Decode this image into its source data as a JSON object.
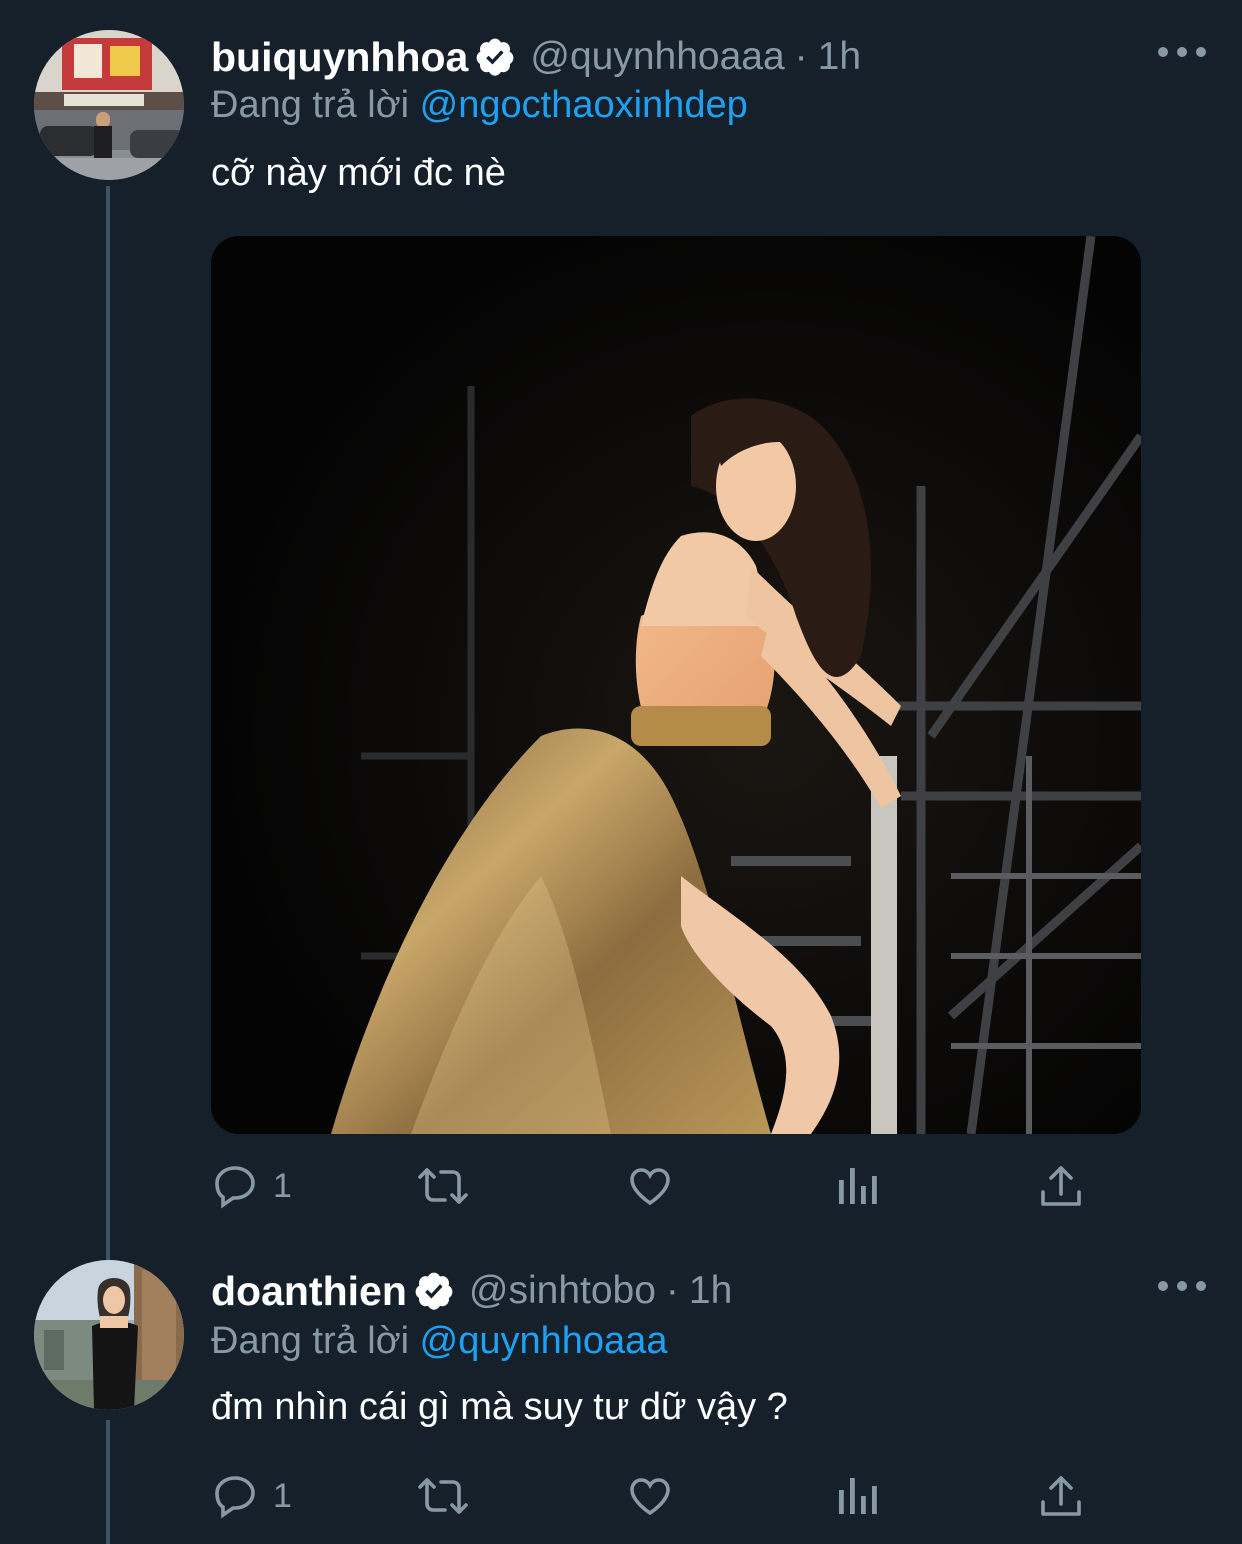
{
  "tweets": [
    {
      "display_name": "buiquynhhoa",
      "handle": "@quynhhoaaa",
      "separator": "·",
      "time": "1h",
      "reply_prefix": "Đang trả lời",
      "reply_to": "@ngocthaoxinhdep",
      "text": "cỡ này mới đc nè",
      "reply_count": "1"
    },
    {
      "display_name": "doanthien",
      "handle": "@sinhtobo",
      "separator": "·",
      "time": "1h",
      "reply_prefix": "Đang trả lời",
      "reply_to": "@quynhhoaaa",
      "text": "đm nhìn cái gì mà suy tư dữ vậy ?",
      "reply_count": "1"
    }
  ],
  "colors": {
    "background": "#15202b",
    "secondary_text": "#8899a6",
    "link": "#1da1f2",
    "thread_line": "#3d5466"
  }
}
